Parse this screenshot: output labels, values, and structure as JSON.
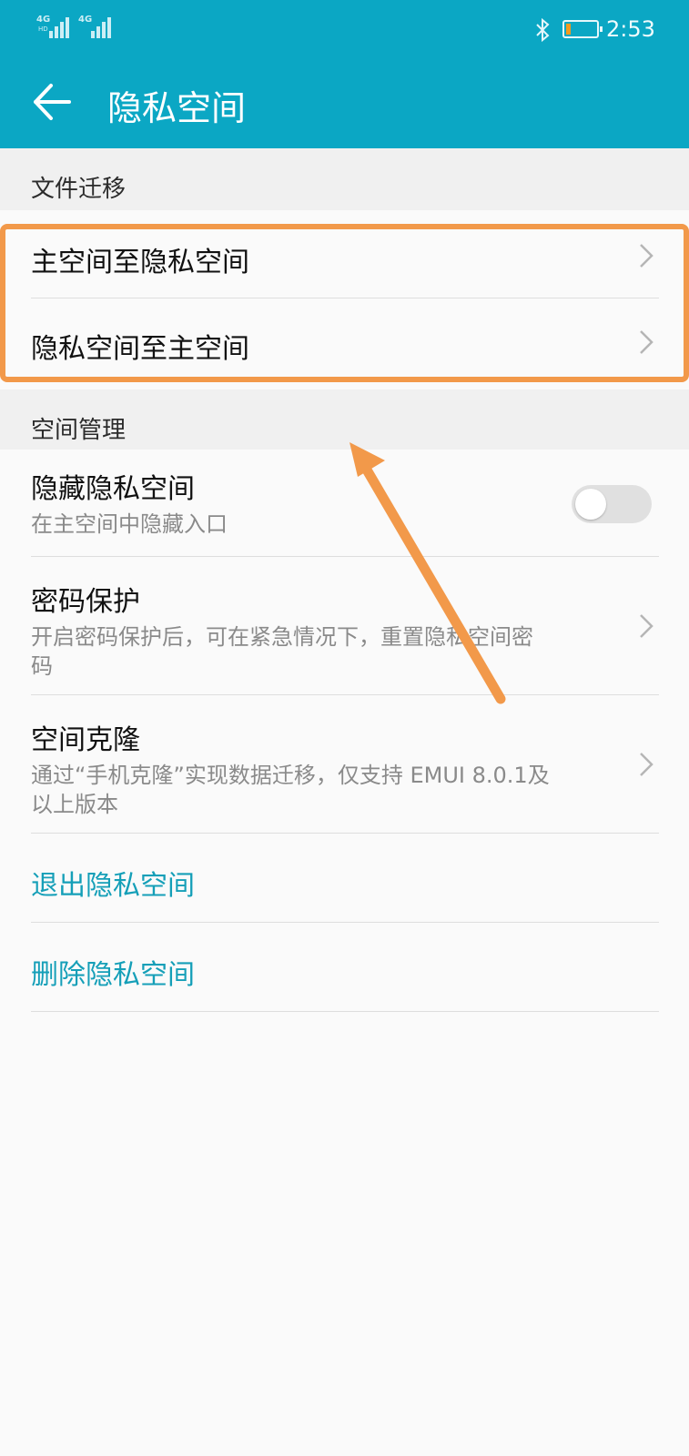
{
  "status_bar": {
    "signal_1": "4G",
    "signal_2": "4G",
    "signal_sub": "HD",
    "time": "2:53",
    "battery_level": 0.15,
    "battery_color": "#f39a1e"
  },
  "header": {
    "title": "隐私空间",
    "back_icon": "arrow-left-icon",
    "background_color": "#0ba7c4"
  },
  "file_transfer": {
    "section_title": "文件迁移",
    "items": [
      {
        "label": "主空间至隐私空间"
      },
      {
        "label": "隐私空间至主空间"
      }
    ]
  },
  "space_management": {
    "section_title": "空间管理",
    "hide": {
      "title": "隐藏隐私空间",
      "desc": "在主空间中隐藏入口",
      "toggle_on": false
    },
    "password": {
      "title": "密码保护",
      "desc_line1": "开启密码保护后，可在紧急情况下，重置隐私空间密",
      "desc_line2": "码"
    },
    "clone": {
      "title": "空间克隆",
      "desc_line1": "通过“手机克隆”实现数据迁移，仅支持 EMUI 8.0.1及",
      "desc_line2": "以上版本"
    }
  },
  "actions": {
    "exit_label": "退出隐私空间",
    "delete_label": "删除隐私空间",
    "accent_color": "#159fb8"
  },
  "annotation": {
    "color": "#f2994a"
  }
}
